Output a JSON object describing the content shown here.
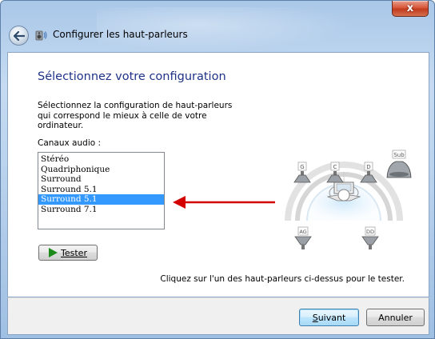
{
  "window": {
    "title": "Configurer les haut-parleurs",
    "close_symbol": "x",
    "back_icon": "back-arrow-icon",
    "wizard_icon": "speaker-wizard-icon"
  },
  "main": {
    "heading": "Sélectionnez votre configuration",
    "description": "Sélectionnez la configuration de haut-parleurs qui correspond le mieux à celle de votre ordinateur.",
    "channels_label": "Canaux audio :",
    "channels": [
      {
        "label": "Stéréo",
        "selected": false
      },
      {
        "label": "Quadriphonique",
        "selected": false
      },
      {
        "label": "Surround",
        "selected": false
      },
      {
        "label": "Surround 5.1",
        "selected": false
      },
      {
        "label": "Surround 5.1",
        "selected": true
      },
      {
        "label": "Surround 7.1",
        "selected": false
      }
    ],
    "test_button": "Tester",
    "hint": "Cliquez sur l'un des haut-parleurs ci-dessus pour le tester.",
    "speakers": {
      "front_left": "G",
      "center": "C",
      "front_right": "D",
      "subwoofer": "Sub",
      "rear_left": "AG",
      "rear_right": "DD"
    },
    "annotation_arrow_color": "#d40000",
    "selection_color": "#3399ff"
  },
  "footer": {
    "next_button": "Suivant",
    "cancel_button": "Annuler"
  }
}
